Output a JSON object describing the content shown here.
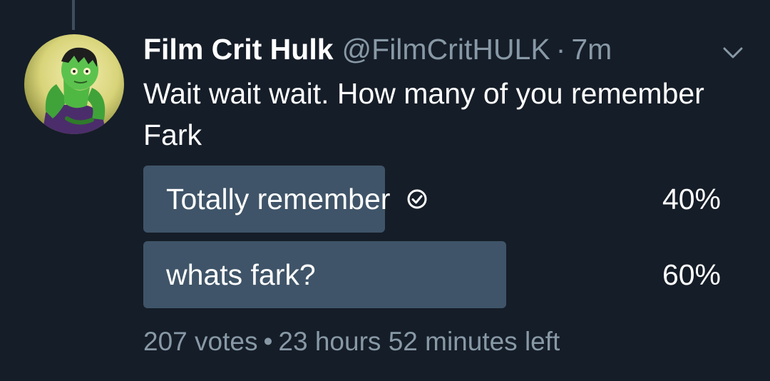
{
  "tweet": {
    "display_name": "Film Crit Hulk",
    "handle": "@FilmCritHULK",
    "separator": "·",
    "time": "7m",
    "text": "Wait wait wait. How many of you remember Fark",
    "avatar_icon": "hulk-avatar",
    "menu_icon": "chevron-down-icon"
  },
  "poll": {
    "options": [
      {
        "label": "Totally remember",
        "percent": "40%",
        "fraction": 0.4,
        "selected": true,
        "icon": "check-circle-icon"
      },
      {
        "label": "whats fark?",
        "percent": "60%",
        "fraction": 0.6,
        "selected": false
      }
    ],
    "votes": "207 votes",
    "separator": "•",
    "time_left": "23 hours 52 minutes left"
  },
  "colors": {
    "background": "#151d28",
    "poll_bar": "#3f5468",
    "secondary_text": "#8899a6",
    "primary_text": "#ffffff"
  }
}
